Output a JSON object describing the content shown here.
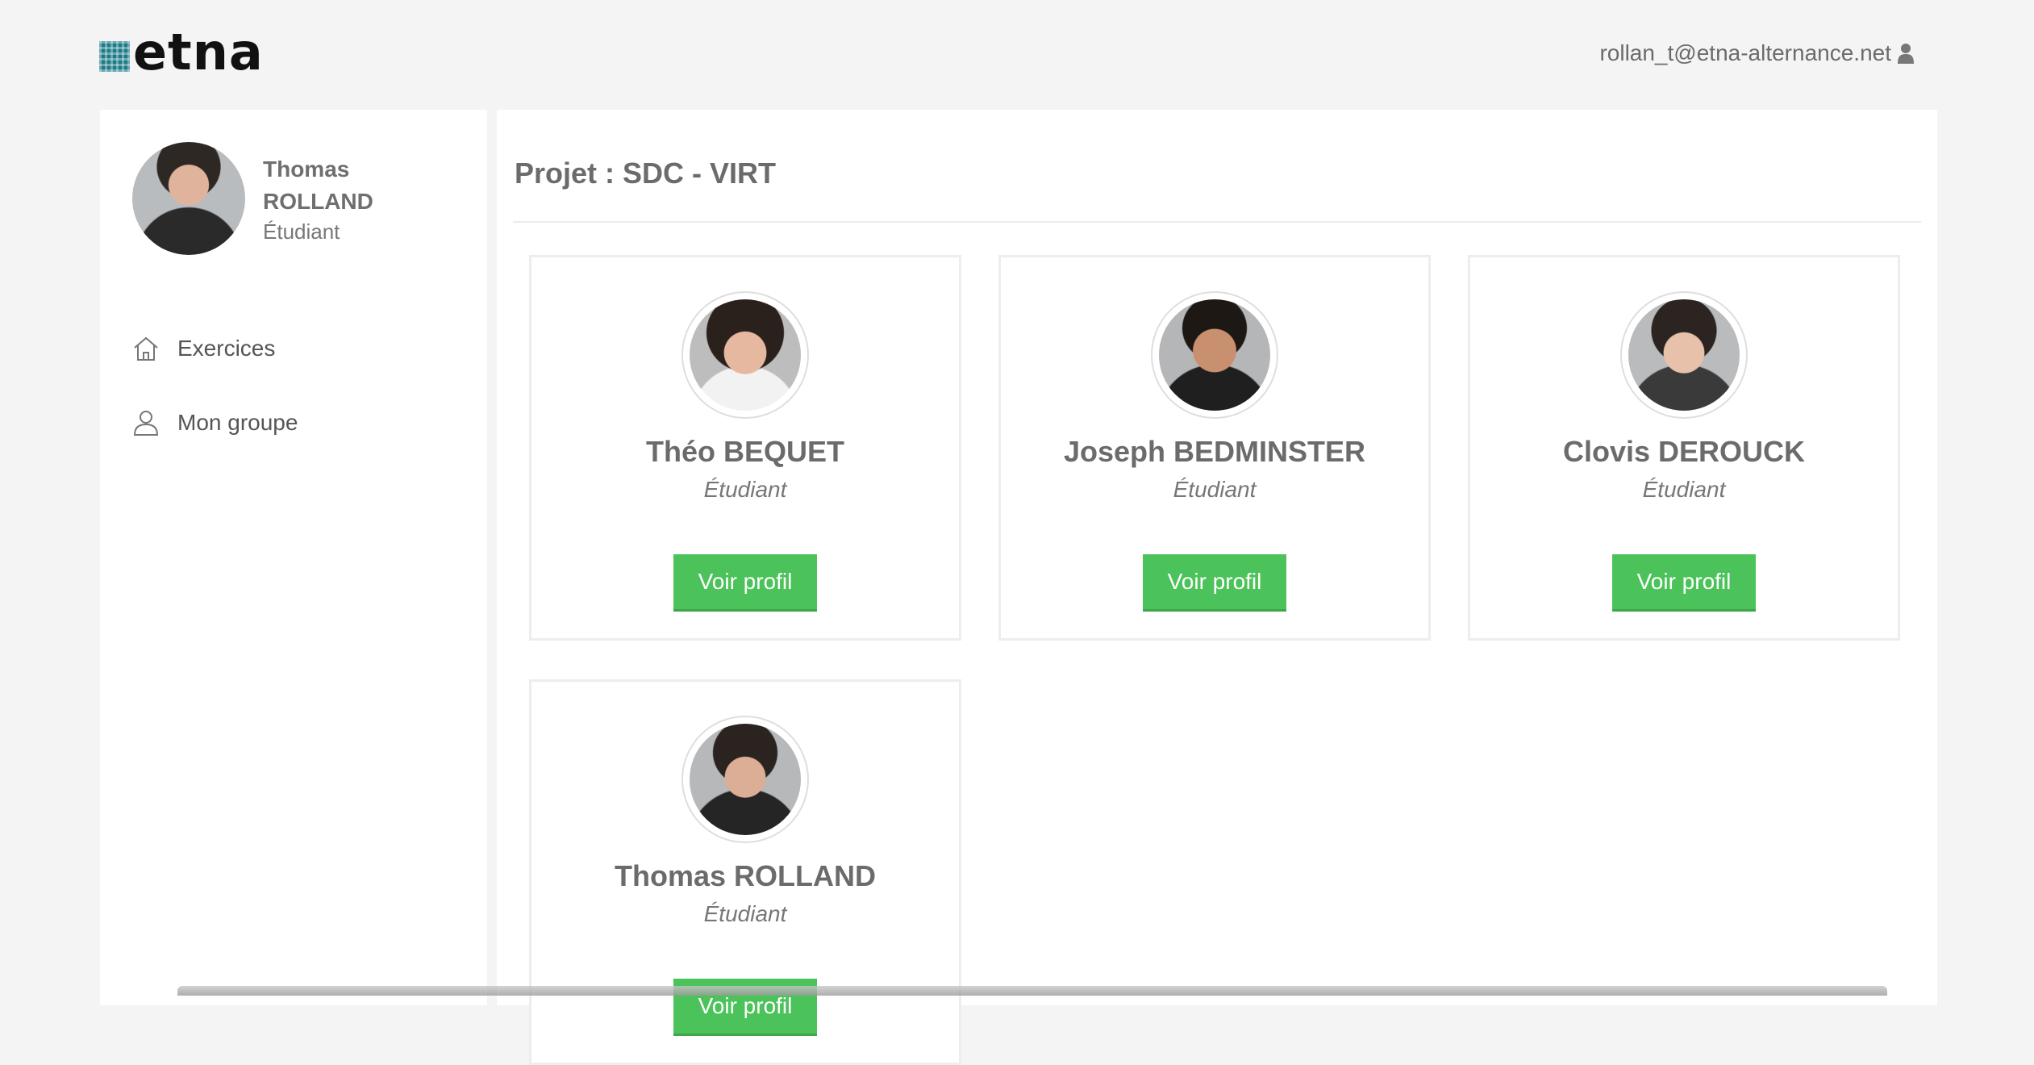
{
  "header": {
    "logo_text": "etna",
    "user_email": "rollan_t@etna-alternance.net"
  },
  "sidebar": {
    "profile": {
      "name": "Thomas ROLLAND",
      "role": "Étudiant"
    },
    "items": [
      {
        "label": "Exercices",
        "icon": "home-icon"
      },
      {
        "label": "Mon groupe",
        "icon": "user-icon"
      }
    ]
  },
  "main": {
    "title": "Projet : SDC - VIRT",
    "members": [
      {
        "name": "Théo BEQUET",
        "role": "Étudiant",
        "button": "Voir profil"
      },
      {
        "name": "Joseph BEDMINSTER",
        "role": "Étudiant",
        "button": "Voir profil"
      },
      {
        "name": "Clovis DEROUCK",
        "role": "Étudiant",
        "button": "Voir profil"
      },
      {
        "name": "Thomas ROLLAND",
        "role": "Étudiant",
        "button": "Voir profil"
      }
    ]
  },
  "colors": {
    "background": "#f4f4f4",
    "accent_button": "#4cc25a",
    "logo_mark": "#1b7a86"
  }
}
